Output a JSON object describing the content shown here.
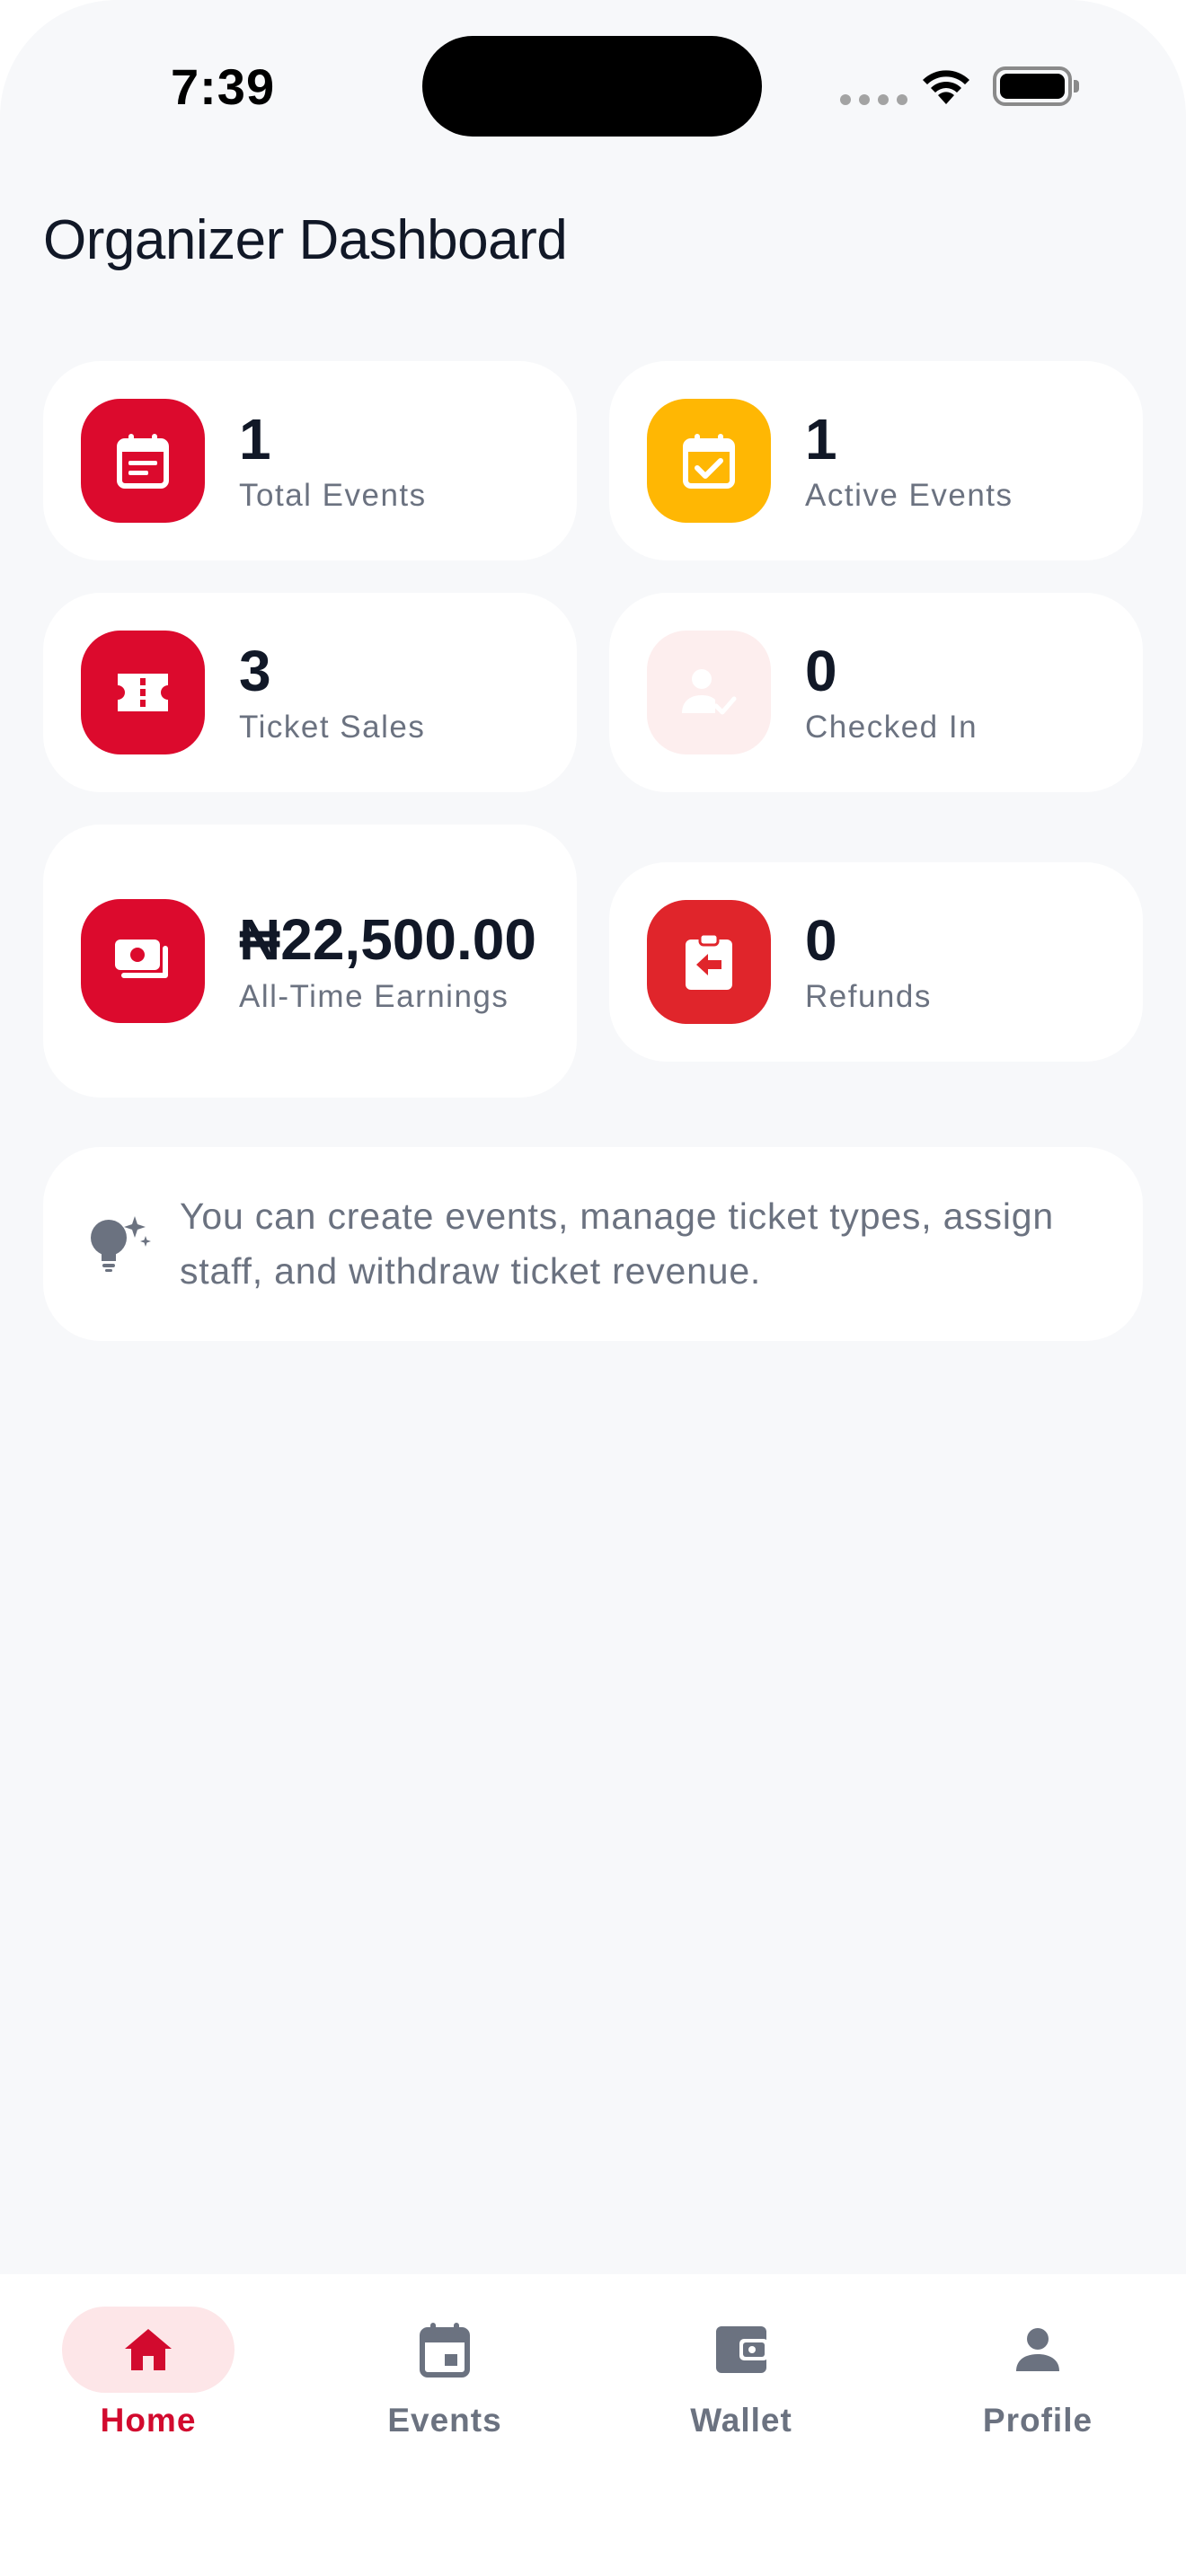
{
  "status_bar": {
    "time": "7:39"
  },
  "header": {
    "title": "Organizer Dashboard"
  },
  "stats": {
    "total_events": {
      "value": "1",
      "label": "Total Events"
    },
    "active_events": {
      "value": "1",
      "label": "Active Events"
    },
    "ticket_sales": {
      "value": "3",
      "label": "Ticket Sales"
    },
    "checked_in": {
      "value": "0",
      "label": "Checked In"
    },
    "earnings": {
      "value": "₦22,500.00",
      "label": "All-Time Earnings"
    },
    "refunds": {
      "value": "0",
      "label": "Refunds"
    }
  },
  "tip": {
    "text": "You can create events, manage ticket types, assign staff, and withdraw ticket revenue."
  },
  "bottom_nav": {
    "items": [
      {
        "label": "Home",
        "icon": "home-icon",
        "active": true
      },
      {
        "label": "Events",
        "icon": "calendar-icon",
        "active": false
      },
      {
        "label": "Wallet",
        "icon": "wallet-icon",
        "active": false
      },
      {
        "label": "Profile",
        "icon": "person-icon",
        "active": false
      }
    ]
  },
  "colors": {
    "brand_red": "#dc0a2d",
    "yellow": "#ffb703",
    "background": "#f7f8fa",
    "muted_text": "#6b7280"
  }
}
